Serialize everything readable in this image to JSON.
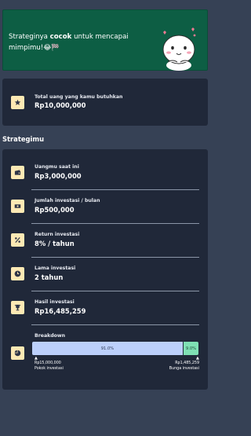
{
  "banner": {
    "text_before": "Strateginya ",
    "text_bold": "cocok",
    "text_after": " untuk mencapai mimpimu!😂🏁"
  },
  "total": {
    "label": "Total uang yang kamu butuhkan",
    "value": "Rp10,000,000"
  },
  "section_title": "Strategimu",
  "items": [
    {
      "label": "Uangmu saat ini",
      "value": "Rp3,000,000",
      "icon": "wallet-icon"
    },
    {
      "label": "Jumlah investasi / bulan",
      "value": "Rp500,000",
      "icon": "cash-icon"
    },
    {
      "label": "Return investasi",
      "value": "8% / tahun",
      "icon": "percent-icon"
    },
    {
      "label": "Lama investasi",
      "value": "2 tahun",
      "icon": "clock-icon"
    },
    {
      "label": "Hasil investasi",
      "value": "Rp16,485,259",
      "icon": "trophy-icon"
    }
  ],
  "breakdown": {
    "label": "Breakdown",
    "a_percent_label": "91.0%",
    "b_percent_label": "9.0%",
    "a_share": 0.91,
    "b_share": 0.09,
    "a_amount": "Rp15,000,000",
    "a_name": "Pokok investasi",
    "b_amount": "Rp1,485,259",
    "b_name": "Bunga investasi",
    "a_color": "#bcd0fb",
    "b_color": "#7fe0b4",
    "icon": "pie-chart-icon"
  },
  "colors": {
    "background": "#364155",
    "card": "#202839",
    "banner": "#0d5e44",
    "icon_bg": "#fde9b4"
  }
}
